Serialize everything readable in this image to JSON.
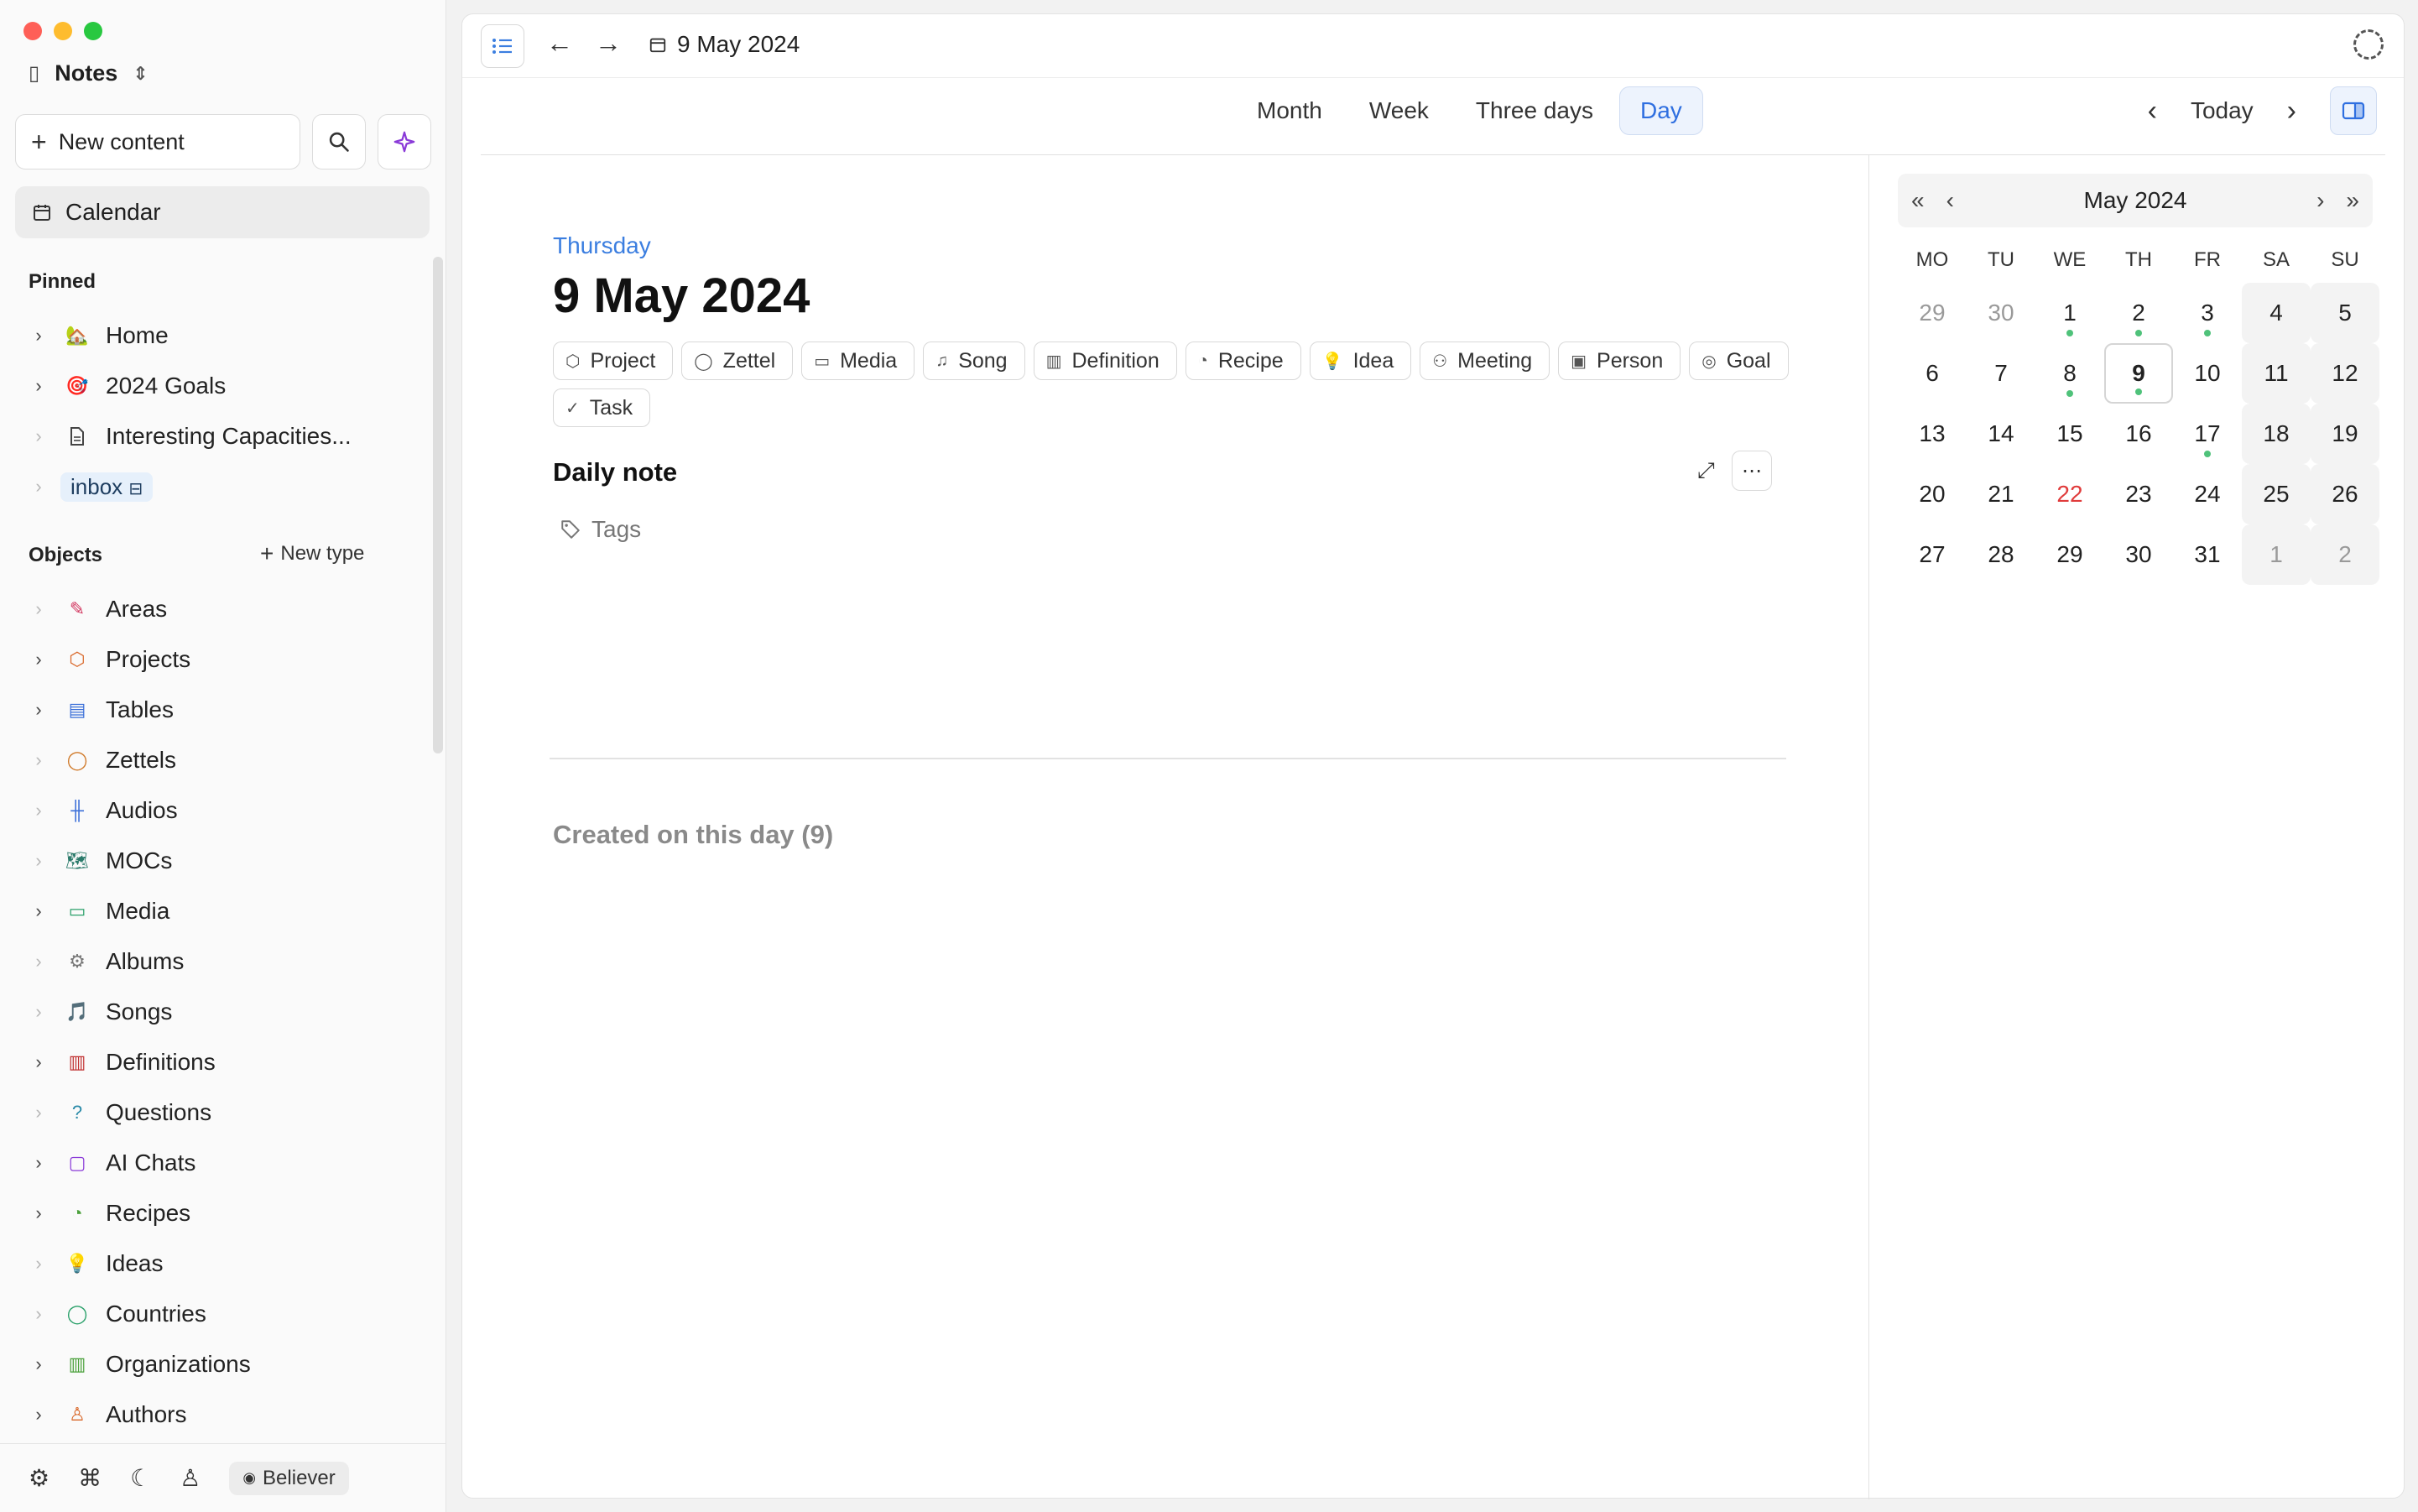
{
  "sidebar": {
    "space_name": "Notes",
    "new_content_label": "New content",
    "calendar_label": "Calendar",
    "pinned_label": "Pinned",
    "pinned": [
      {
        "label": "Home",
        "icon": "🏡"
      },
      {
        "label": "2024 Goals",
        "icon": "🎯"
      },
      {
        "label": "Interesting Capacities..."
      },
      {
        "label": "inbox"
      }
    ],
    "objects_label": "Objects",
    "new_type_label": "New type",
    "objects": [
      {
        "label": "Areas",
        "icon": "✎",
        "color": "#d2365f"
      },
      {
        "label": "Projects",
        "icon": "⬡",
        "color": "#d9682a"
      },
      {
        "label": "Tables",
        "icon": "▤",
        "color": "#3b6fd8"
      },
      {
        "label": "Zettels",
        "icon": "◯",
        "color": "#d07a2a"
      },
      {
        "label": "Audios",
        "icon": "╫",
        "color": "#3b6fd8"
      },
      {
        "label": "MOCs",
        "icon": "🗺",
        "color": "#2a7a6a"
      },
      {
        "label": "Media",
        "icon": "▭",
        "color": "#2aa06a"
      },
      {
        "label": "Albums",
        "icon": "⚙",
        "color": "#777777"
      },
      {
        "label": "Songs",
        "icon": "🎵",
        "color": "#333333"
      },
      {
        "label": "Definitions",
        "icon": "▥",
        "color": "#c03030"
      },
      {
        "label": "Questions",
        "icon": "?",
        "color": "#2a8aa8"
      },
      {
        "label": "AI Chats",
        "icon": "▢",
        "color": "#8a3ad8"
      },
      {
        "label": "Recipes",
        "icon": "◔",
        "color": "#4aa03a"
      },
      {
        "label": "Ideas",
        "icon": "💡",
        "color": "#e0a020"
      },
      {
        "label": "Countries",
        "icon": "◯",
        "color": "#2aa06a"
      },
      {
        "label": "Organizations",
        "icon": "▥",
        "color": "#4aa03a"
      },
      {
        "label": "Authors",
        "icon": "♙",
        "color": "#d9682a"
      }
    ],
    "footer_user": "Believer"
  },
  "topbar": {
    "current_date": "9 May 2024"
  },
  "views": {
    "tabs": [
      "Month",
      "Week",
      "Three days",
      "Day"
    ],
    "active": "Day",
    "today_label": "Today"
  },
  "day": {
    "weekday": "Thursday",
    "title": "9 May 2024",
    "types": [
      {
        "label": "Project",
        "icon": "⬡"
      },
      {
        "label": "Zettel",
        "icon": "◯"
      },
      {
        "label": "Media",
        "icon": "▭"
      },
      {
        "label": "Song",
        "icon": "♫"
      },
      {
        "label": "Definition",
        "icon": "▥"
      },
      {
        "label": "Recipe",
        "icon": "◔"
      },
      {
        "label": "Idea",
        "icon": "💡"
      },
      {
        "label": "Meeting",
        "icon": "⚇"
      },
      {
        "label": "Person",
        "icon": "▣"
      },
      {
        "label": "Goal",
        "icon": "◎"
      },
      {
        "label": "Task",
        "icon": "✓"
      }
    ],
    "note_title": "Daily note",
    "tags_placeholder": "Tags",
    "created_label": "Created on this day (9)"
  },
  "mini_calendar": {
    "month_label": "May 2024",
    "weekdays": [
      "MO",
      "TU",
      "WE",
      "TH",
      "FR",
      "SA",
      "SU"
    ],
    "days": [
      {
        "d": "29",
        "muted": true
      },
      {
        "d": "30",
        "muted": true
      },
      {
        "d": "1",
        "dot": true
      },
      {
        "d": "2",
        "dot": true
      },
      {
        "d": "3",
        "dot": true
      },
      {
        "d": "4",
        "weekend": true
      },
      {
        "d": "5",
        "weekend": true
      },
      {
        "d": "6"
      },
      {
        "d": "7"
      },
      {
        "d": "8",
        "dot": true
      },
      {
        "d": "9",
        "selected": true,
        "dot": true
      },
      {
        "d": "10"
      },
      {
        "d": "11",
        "weekend": true
      },
      {
        "d": "12",
        "weekend": true
      },
      {
        "d": "13"
      },
      {
        "d": "14"
      },
      {
        "d": "15"
      },
      {
        "d": "16"
      },
      {
        "d": "17",
        "dot": true
      },
      {
        "d": "18",
        "weekend": true
      },
      {
        "d": "19",
        "weekend": true
      },
      {
        "d": "20"
      },
      {
        "d": "21"
      },
      {
        "d": "22",
        "today": true
      },
      {
        "d": "23"
      },
      {
        "d": "24"
      },
      {
        "d": "25",
        "weekend": true
      },
      {
        "d": "26",
        "weekend": true
      },
      {
        "d": "27"
      },
      {
        "d": "28"
      },
      {
        "d": "29"
      },
      {
        "d": "30"
      },
      {
        "d": "31"
      },
      {
        "d": "1",
        "muted": true,
        "weekend": true
      },
      {
        "d": "2",
        "muted": true,
        "weekend": true
      }
    ]
  }
}
